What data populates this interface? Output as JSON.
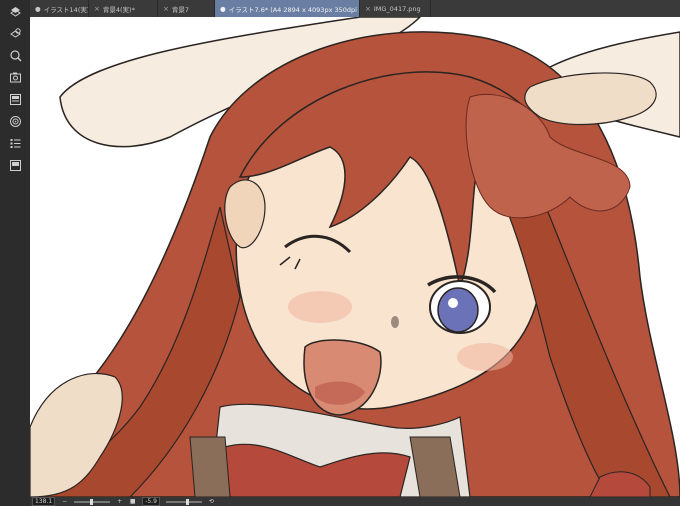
{
  "tabs": [
    {
      "label": "イラスト14(実)",
      "close": "×",
      "active": false
    },
    {
      "label": "背景4(実)*",
      "close": "×",
      "active": false
    },
    {
      "label": "背景7",
      "close": "×",
      "active": false
    },
    {
      "label": "イラスト7.6* (A4 2894 x 4093px 350dpi 138.1%)",
      "close": "×",
      "active": true
    },
    {
      "label": "IMG_0417.png",
      "close": "×",
      "active": false
    }
  ],
  "toolbar": {
    "icons": [
      "layer-property-icon",
      "search-layer-icon",
      "navigator-icon",
      "sub-view-icon",
      "material-icon",
      "history-icon",
      "auto-actions-icon",
      "item-bank-icon"
    ]
  },
  "status": {
    "zoom": "138.1",
    "angle": "-5.9",
    "minus": "−",
    "plus": "+"
  },
  "colors": {
    "hair": "#b5533c",
    "hair_dark": "#8e3a2a",
    "skin": "#f8e4cf",
    "ear": "#f6ece0",
    "eye": "#6b72b8",
    "tab_active": "#6a7ea3"
  }
}
